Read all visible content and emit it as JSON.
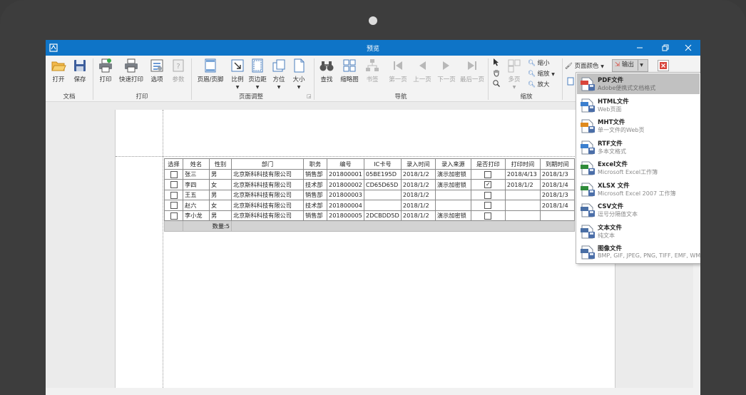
{
  "window": {
    "title": "预览"
  },
  "ribbon": {
    "doc_group": {
      "label": "文档",
      "open": "打开",
      "save": "保存"
    },
    "print_group": {
      "label": "打印",
      "print": "打印",
      "quick_print": "快速打印",
      "options": "选项",
      "params": "参数"
    },
    "page_group": {
      "label": "页面调整",
      "header_footer": "页眉/页脚",
      "scale": "比例",
      "margins": "页边距",
      "orientation": "方位",
      "size": "大小"
    },
    "nav_group": {
      "label": "导航",
      "find": "查找",
      "thumbnails": "缩略图",
      "bookmark": "书签",
      "first": "第一页",
      "prev": "上一页",
      "next": "下一页",
      "last": "最后一页"
    },
    "zoom_group": {
      "label": "缩放",
      "multi_page": "多页",
      "zoom_out": "缩小",
      "zoom": "缩放",
      "zoom_in": "放大"
    },
    "page_color": "页面颜色",
    "export": "输出"
  },
  "report": {
    "columns": [
      "选择",
      "姓名",
      "性别",
      "部门",
      "职务",
      "编号",
      "IC卡号",
      "录入时间",
      "录入来源",
      "是否打印",
      "打印时间",
      "到期时间"
    ],
    "rows": [
      {
        "name": "张三",
        "gender": "男",
        "dept": "北京斯科科技有限公司",
        "role": "销售部",
        "id": "201800001",
        "ic": "05BE195D",
        "entry_time": "2018/1/2",
        "source": "演示加密锁",
        "printed": false,
        "print_time": "2018/4/13",
        "expire": "2018/1/3"
      },
      {
        "name": "李四",
        "gender": "女",
        "dept": "北京斯科科技有限公司",
        "role": "技术部",
        "id": "201800002",
        "ic": "CD65D65D",
        "entry_time": "2018/1/2",
        "source": "演示加密锁",
        "printed": true,
        "print_time": "2018/1/2",
        "expire": "2018/1/4"
      },
      {
        "name": "王五",
        "gender": "男",
        "dept": "北京斯科科技有限公司",
        "role": "销售部",
        "id": "201800003",
        "ic": "",
        "entry_time": "2018/1/2",
        "source": "",
        "printed": false,
        "print_time": "",
        "expire": "2018/1/3"
      },
      {
        "name": "赵六",
        "gender": "女",
        "dept": "北京斯科科技有限公司",
        "role": "技术部",
        "id": "201800004",
        "ic": "",
        "entry_time": "2018/1/2",
        "source": "",
        "printed": false,
        "print_time": "",
        "expire": "2018/1/4"
      },
      {
        "name": "李小龙",
        "gender": "男",
        "dept": "北京斯科科技有限公司",
        "role": "销售部",
        "id": "201800005",
        "ic": "2DCBDD5D",
        "entry_time": "2018/1/2",
        "source": "演示加密锁",
        "printed": false,
        "print_time": "",
        "expire": ""
      }
    ],
    "summary": "数量:5"
  },
  "export_menu": {
    "items": [
      {
        "title": "PDF文件",
        "desc": "Adobe便携式文档格式",
        "icon": "pdf-file-icon",
        "color": "#d9453b"
      },
      {
        "title": "HTML文件",
        "desc": "Web页面",
        "icon": "html-file-icon",
        "color": "#3b7fcf"
      },
      {
        "title": "MHT文件",
        "desc": "单一文件的Web页",
        "icon": "mht-file-icon",
        "color": "#e08a1e"
      },
      {
        "title": "RTF文件",
        "desc": "多本文格式",
        "icon": "rtf-file-icon",
        "color": "#3b7fcf"
      },
      {
        "title": "Excel文件",
        "desc": "Microsoft Excel工作簿",
        "icon": "excel-file-icon",
        "color": "#2e8b3a"
      },
      {
        "title": "XLSX 文件",
        "desc": "Microsoft Excel 2007 工作簿",
        "icon": "xlsx-file-icon",
        "color": "#2e8b3a"
      },
      {
        "title": "CSV文件",
        "desc": "逗号分隔值文本",
        "icon": "csv-file-icon",
        "color": "#4a6fa5"
      },
      {
        "title": "文本文件",
        "desc": "纯文本",
        "icon": "text-file-icon",
        "color": "#4a6fa5"
      },
      {
        "title": "图像文件",
        "desc": "BMP, GIF, JPEG, PNG, TIFF, EMF, WMF",
        "icon": "image-file-icon",
        "color": "#4a6fa5"
      }
    ]
  },
  "colors": {
    "titlebar": "#0e74c7",
    "selected_item": "#c1c1c1"
  }
}
